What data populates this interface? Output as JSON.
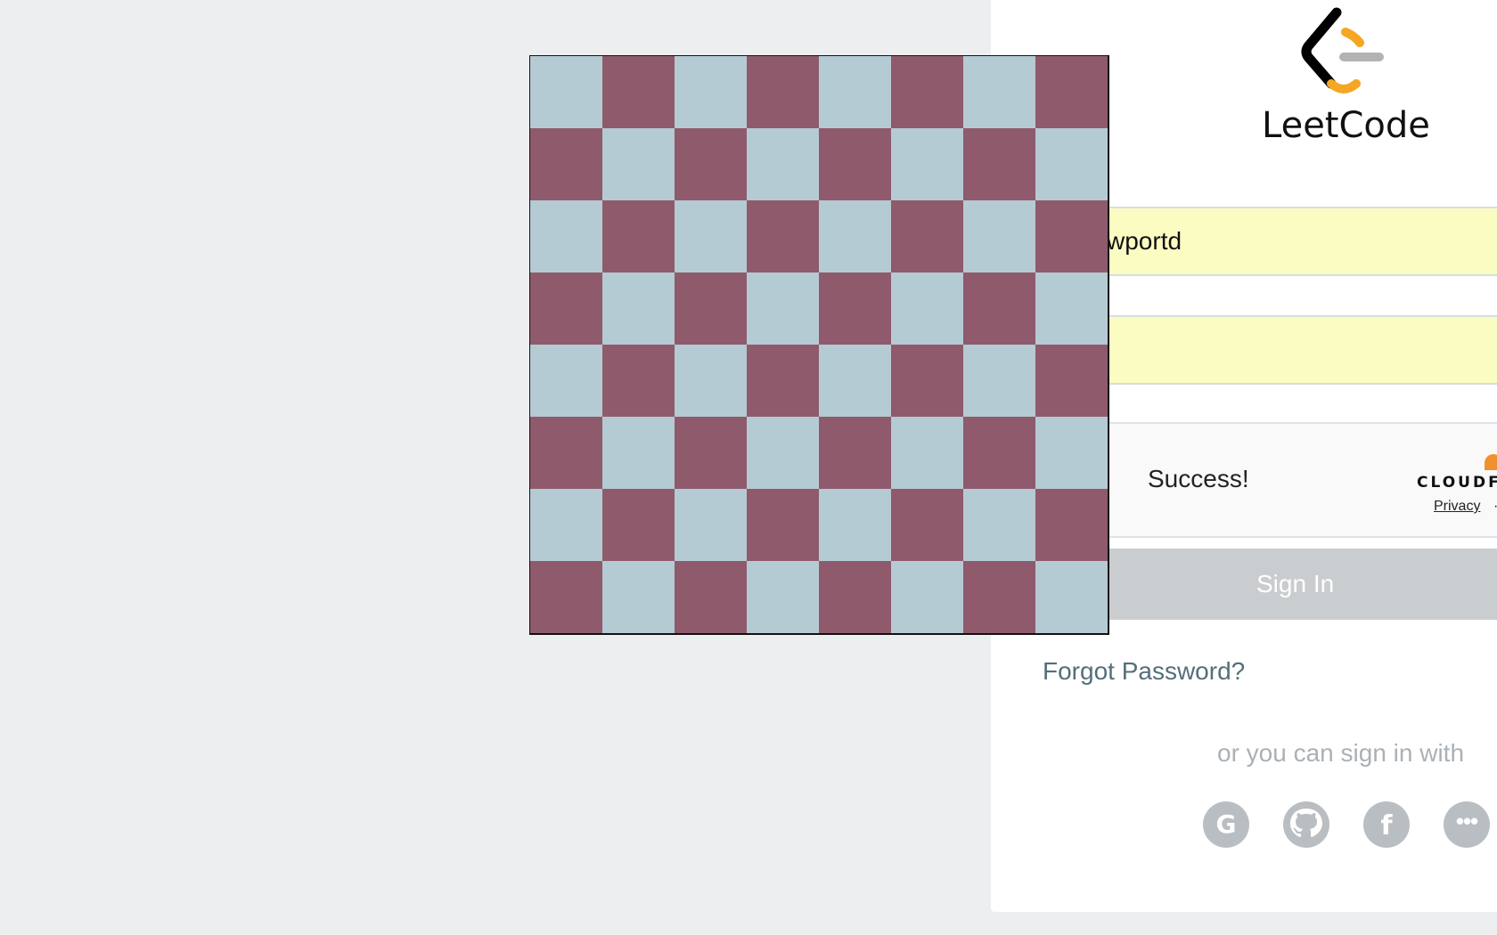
{
  "brand": {
    "name": "LeetCode",
    "logo_colors": {
      "dark": "#000000",
      "orange": "#f5a623",
      "gray": "#b3b3b3"
    }
  },
  "login": {
    "username_value": "wportd",
    "password_mask": "●●●●●●●●●●",
    "captcha_status": "Success!",
    "captcha_provider": "CLOUDF",
    "captcha_privacy": "Privacy",
    "captcha_separator": "·",
    "signin_label": "Sign In",
    "forgot_label": "Forgot Password?",
    "alt_signin_label": "or you can sign in with",
    "social": [
      {
        "name": "google-icon",
        "glyph": "G"
      },
      {
        "name": "github-icon",
        "glyph": ""
      },
      {
        "name": "facebook-icon",
        "glyph": "f"
      },
      {
        "name": "more-icon",
        "glyph": "•••"
      }
    ]
  },
  "board": {
    "rows": 8,
    "cols": 8,
    "light_color": "#b5cbd3",
    "dark_color": "#8f5a6c"
  },
  "colors": {
    "background": "#eceef0",
    "autofill": "#fafcc2",
    "signin_disabled": "#c9cdd0",
    "link": "#546e7a",
    "success_green": "#3b8a3a",
    "cloudflare_orange": "#f0912f"
  }
}
